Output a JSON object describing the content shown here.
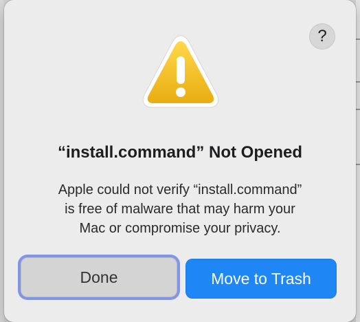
{
  "dialog": {
    "help_label": "?",
    "title": "“install.command” Not Opened",
    "message_lines": [
      "Apple could not verify “install.command”",
      "is free of malware that may harm your",
      "Mac or compromise your privacy."
    ],
    "buttons": {
      "done_label": "Done",
      "trash_label": "Move to Trash"
    },
    "icon": "warning-icon"
  },
  "colors": {
    "accent": "#1f87f5",
    "focus_ring": "#8094e8",
    "warning_yellow": "#f2c21b"
  }
}
